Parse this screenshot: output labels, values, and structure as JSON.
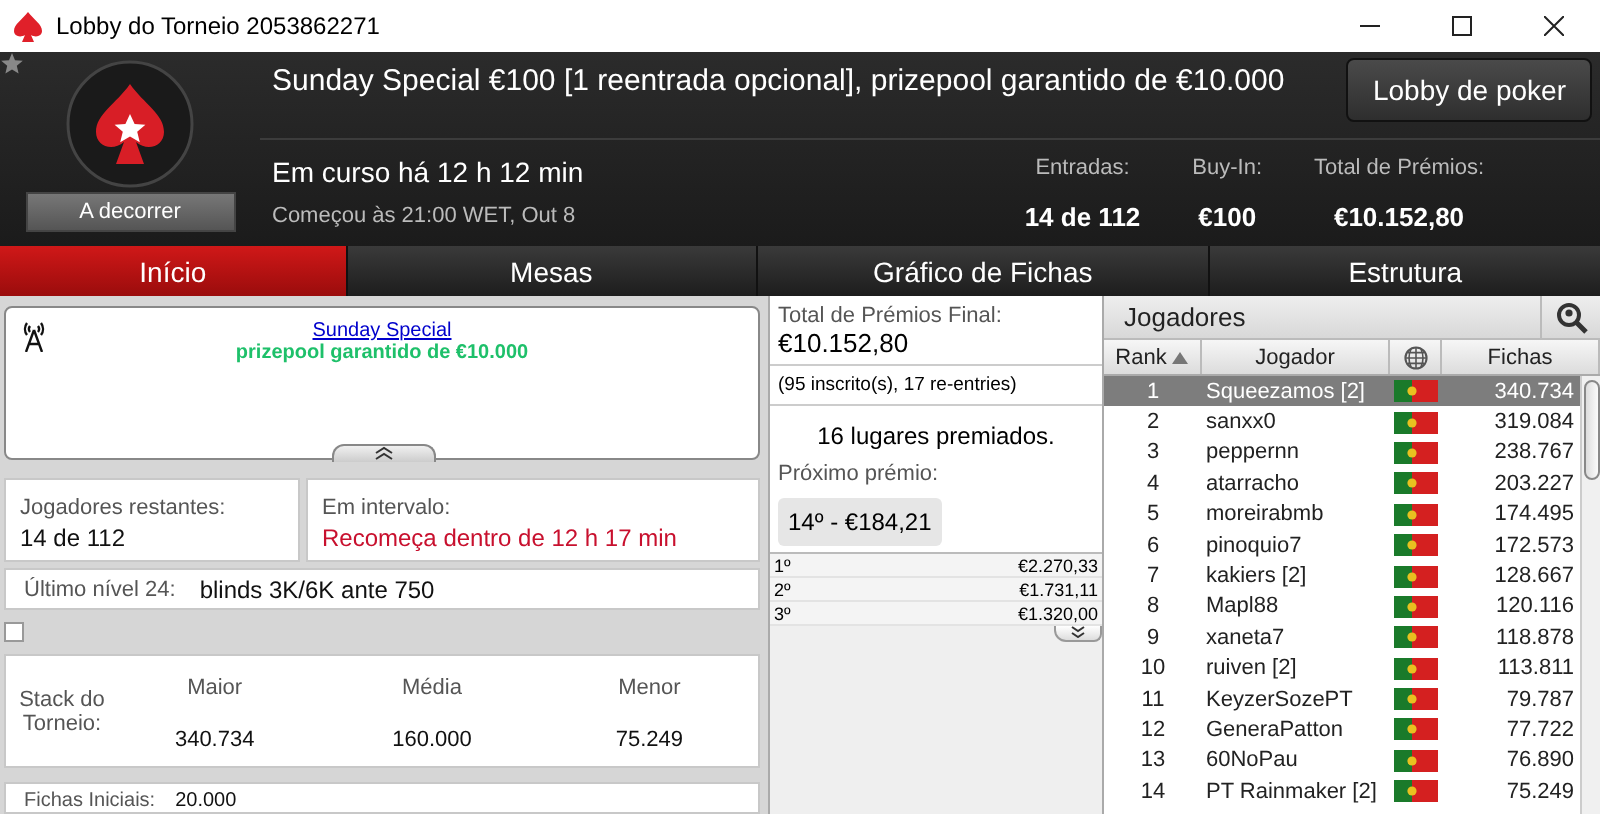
{
  "window": {
    "title": "Lobby do Torneio 2053862271"
  },
  "header": {
    "title": "Sunday Special €100 [1 reentrada opcional], prizepool garantido de €10.000",
    "status": "A decorrer",
    "button": "Lobby de poker",
    "elapsed": "Em curso há 12 h 12 min",
    "started": "Começou às 21:00 WET, Out 8",
    "stats": [
      {
        "label": "Entradas:",
        "value": "14 de 112"
      },
      {
        "label": "Buy-In:",
        "value": "€100"
      },
      {
        "label": "Total de Prémios:",
        "value": "€10.152,80"
      }
    ]
  },
  "tabs": [
    {
      "label": "Início",
      "selected": true
    },
    {
      "label": "Mesas",
      "selected": false
    },
    {
      "label": "Gráfico de Fichas",
      "selected": false
    },
    {
      "label": "Estrutura",
      "selected": false
    }
  ],
  "news": {
    "link": "Sunday Special",
    "text": "prizepool garantido de €10.000"
  },
  "players_left": {
    "label": "Jogadores restantes:",
    "value": "14 de 112"
  },
  "break": {
    "label": "Em intervalo:",
    "value": "Recomeça dentro de 12 h 17 min"
  },
  "last_level": {
    "label": "Último nível 24:",
    "value": "blinds 3K/6K ante 750"
  },
  "option_checkbox": {
    "checked": false
  },
  "stack": {
    "label": "Stack do Torneio:",
    "columns": [
      {
        "label": "Maior",
        "value": "340.734"
      },
      {
        "label": "Média",
        "value": "160.000"
      },
      {
        "label": "Menor",
        "value": "75.249"
      }
    ]
  },
  "starting_chips": {
    "label": "Fichas Iniciais:",
    "value": "20.000"
  },
  "prizes": {
    "label": "Total de Prémios Final:",
    "total": "€10.152,80",
    "entries": "(95 inscrito(s), 17 re-entries)",
    "paid": "16 lugares premiados.",
    "next_label": "Próximo prémio:",
    "next_value": "14º - €184,21",
    "rows": [
      {
        "place": "1º",
        "amount": "€2.270,33"
      },
      {
        "place": "2º",
        "amount": "€1.731,11"
      },
      {
        "place": "3º",
        "amount": "€1.320,00"
      }
    ]
  },
  "players": {
    "title": "Jogadores",
    "columns": [
      "Rank",
      "Jogador",
      "Fichas"
    ],
    "rows": [
      {
        "rank": "1",
        "name": "Squeezamos [2]",
        "chips": "340.734",
        "selected": true
      },
      {
        "rank": "2",
        "name": "sanxx0",
        "chips": "319.084",
        "selected": false
      },
      {
        "rank": "3",
        "name": "peppernn",
        "chips": "238.767",
        "selected": false
      },
      {
        "rank": "4",
        "name": "atarracho",
        "chips": "203.227",
        "selected": false
      },
      {
        "rank": "5",
        "name": "moreirabmb",
        "chips": "174.495",
        "selected": false
      },
      {
        "rank": "6",
        "name": "pinoquio7",
        "chips": "172.573",
        "selected": false
      },
      {
        "rank": "7",
        "name": "kakiers [2]",
        "chips": "128.667",
        "selected": false
      },
      {
        "rank": "8",
        "name": "Mapl88",
        "chips": "120.116",
        "selected": false
      },
      {
        "rank": "9",
        "name": "xaneta7",
        "chips": "118.878",
        "selected": false
      },
      {
        "rank": "10",
        "name": "ruiven [2]",
        "chips": "113.811",
        "selected": false
      },
      {
        "rank": "11",
        "name": "KeyzerSozePT",
        "chips": "79.787",
        "selected": false
      },
      {
        "rank": "12",
        "name": "GeneraPatton",
        "chips": "77.722",
        "selected": false
      },
      {
        "rank": "13",
        "name": "60NoPau",
        "chips": "76.890",
        "selected": false
      },
      {
        "rank": "14",
        "name": "PT Rainmaker [2]",
        "chips": "75.249",
        "selected": false
      }
    ]
  }
}
